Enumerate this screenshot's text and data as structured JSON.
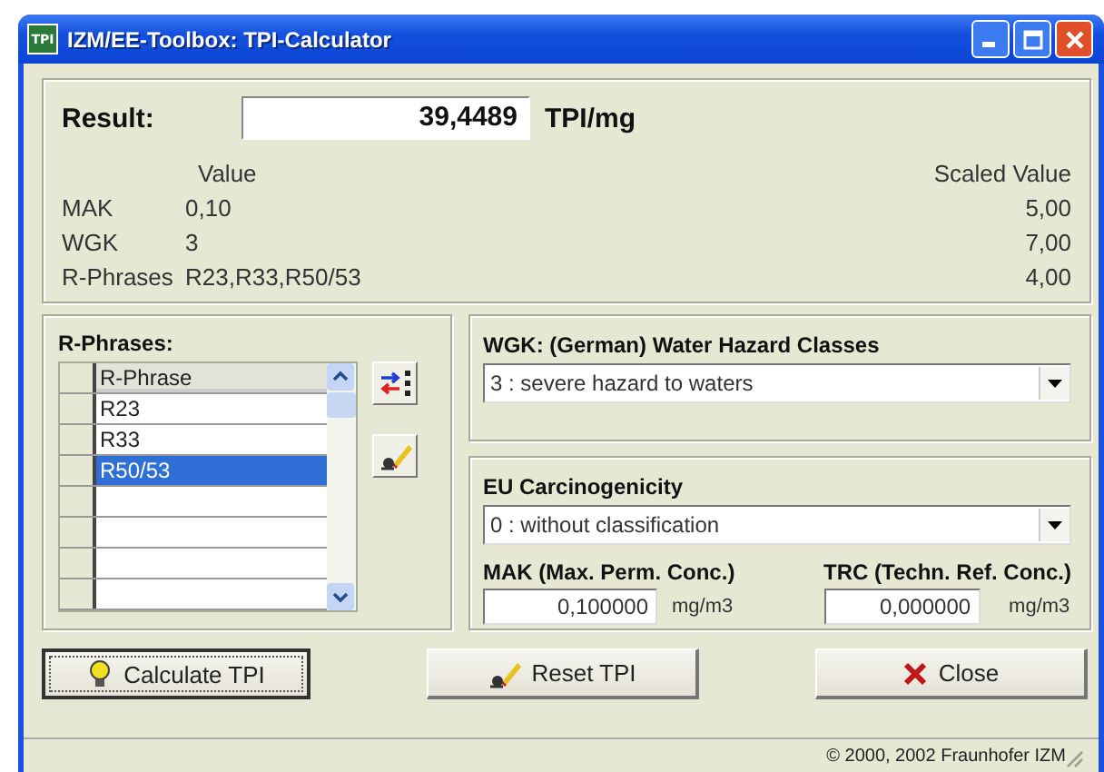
{
  "window": {
    "title": "IZM/EE-Toolbox:  TPI-Calculator",
    "icon_text": "TPI"
  },
  "result": {
    "label": "Result:",
    "value": "39,4489",
    "unit": "TPI/mg"
  },
  "values": {
    "value_header": "Value",
    "scaled_header": "Scaled Value",
    "rows": [
      {
        "name": "MAK",
        "value": "0,10",
        "scaled": "5,00"
      },
      {
        "name": "WGK",
        "value": "3",
        "scaled": "7,00"
      },
      {
        "name": "R-Phrases",
        "value": "R23,R33,R50/53",
        "scaled": "4,00"
      }
    ]
  },
  "r_phrases": {
    "title": "R-Phrases:",
    "column": "R-Phrase",
    "rows": [
      {
        "text": "R23",
        "selected": false
      },
      {
        "text": "R33",
        "selected": false
      },
      {
        "text": "R50/53",
        "selected": true
      }
    ]
  },
  "wgk": {
    "title": "WGK: (German) Water Hazard Classes",
    "value": "3 : severe hazard to waters"
  },
  "eu": {
    "title": "EU Carcinogenicity",
    "value": "0 : without classification"
  },
  "concs": [
    {
      "label": "MAK (Max. Perm. Conc.)",
      "value": "0,100000",
      "unit": "mg/m3"
    },
    {
      "label": "TRC (Techn. Ref. Conc.)",
      "value": "0,000000",
      "unit": "mg/m3"
    }
  ],
  "buttons": [
    {
      "label": "Calculate TPI",
      "kind": "calculate",
      "focused": true
    },
    {
      "label": "Reset TPI",
      "kind": "reset",
      "focused": false
    },
    {
      "label": "Close",
      "kind": "close",
      "focused": false
    }
  ],
  "status_bar": "© 2000, 2002 Fraunhofer IZM"
}
